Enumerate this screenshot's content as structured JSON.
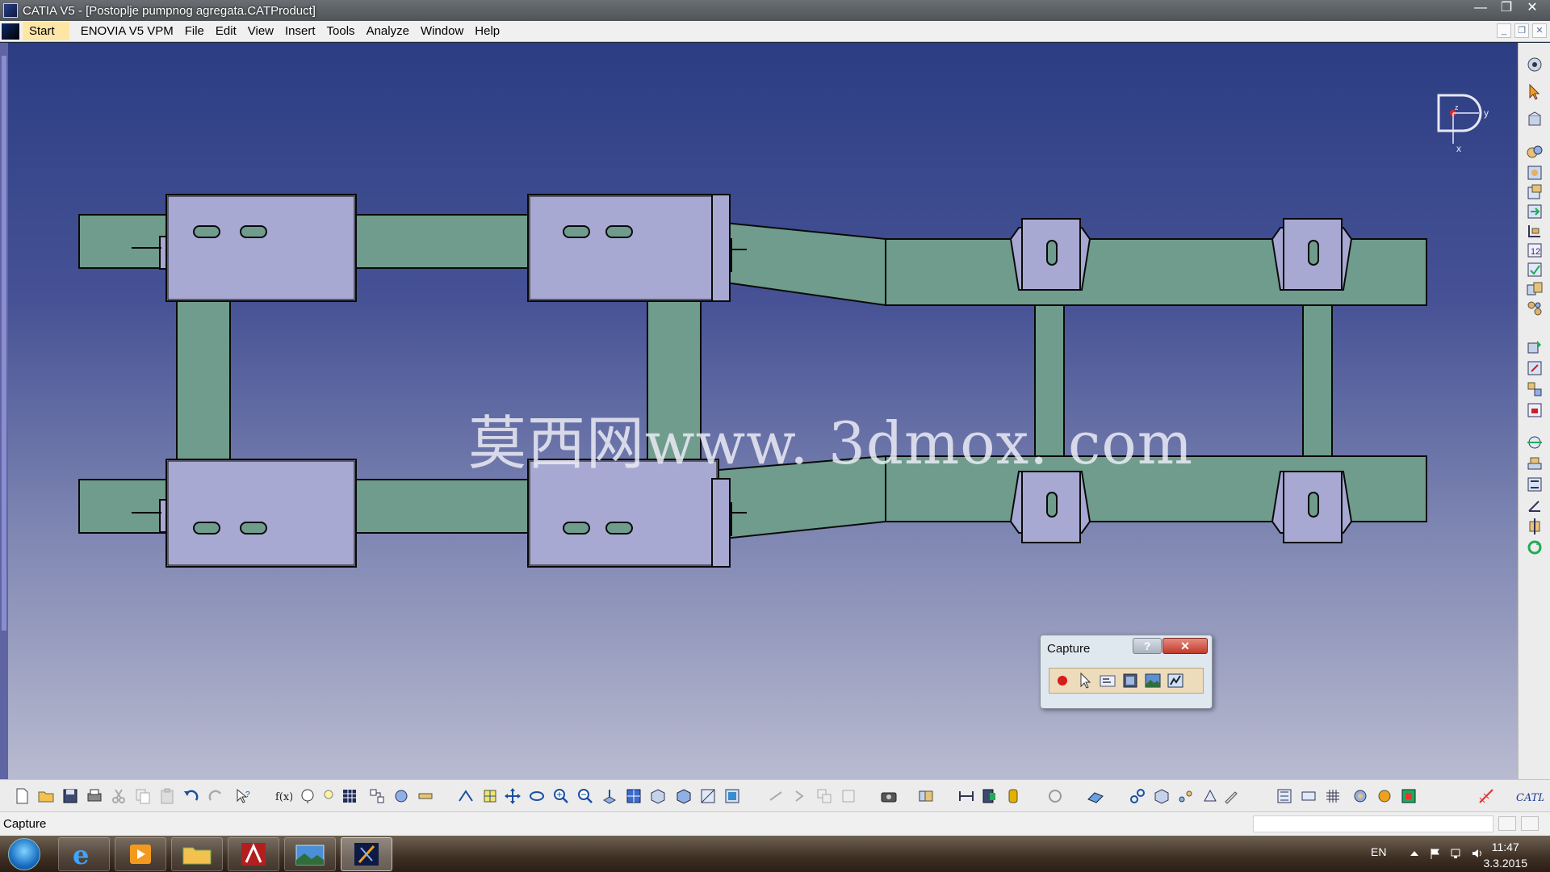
{
  "window": {
    "title": "CATIA V5 - [Postoplje pumpnog agregata.CATProduct]"
  },
  "menu": {
    "items": [
      "Start",
      "ENOVIA V5 VPM",
      "File",
      "Edit",
      "View",
      "Insert",
      "Tools",
      "Analyze",
      "Window",
      "Help"
    ]
  },
  "viewport": {
    "watermark": "莫西网www. 3dmox. com",
    "compass": {
      "y_label": "y",
      "x_label": "x",
      "z_label": "z"
    }
  },
  "capture_dialog": {
    "title": "Capture",
    "help_label": "?",
    "close_label": "✕",
    "tools": [
      "record-icon",
      "select-icon",
      "capture-options-icon",
      "capture-mode-icon",
      "image-album-icon",
      "capture-settings-icon"
    ]
  },
  "status": {
    "text": "Capture",
    "command_input": ""
  },
  "taskbar": {
    "apps": [
      "internet-explorer-icon",
      "media-player-icon",
      "file-explorer-icon",
      "autocad-icon",
      "image-viewer-icon",
      "catia-icon"
    ],
    "language": "EN",
    "time": "11:47",
    "date": "3.3.2015"
  },
  "colors": {
    "frame_fill": "#6f9c8c",
    "plate_fill": "#a7a9d2",
    "outline": "#0a0a0a",
    "background_top": "#2c3d83",
    "background_bottom": "#b9bbd0"
  }
}
